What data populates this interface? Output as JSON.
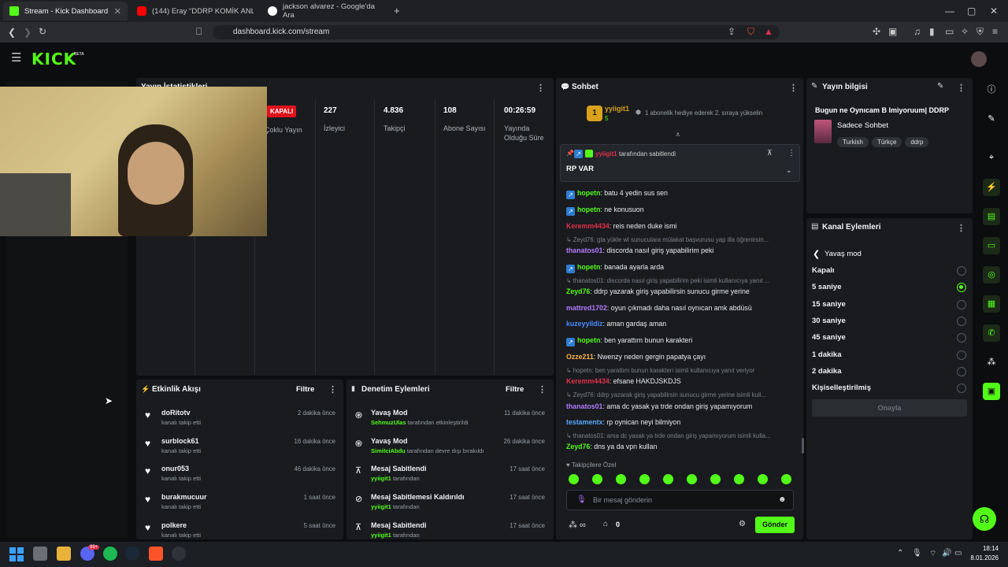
{
  "browser": {
    "tabs": [
      {
        "title": "Stream - Kick Dashboard",
        "color": "#53fc18"
      },
      {
        "title": "(144) Eray \"DDRP KOMİK ANLAR 11.",
        "color": "#ff0000"
      },
      {
        "title": "jackson alvarez - Google'da Ara",
        "color": "#ffffff"
      }
    ],
    "new_tab": "+",
    "url": "dashboard.kick.com/stream",
    "window_controls": [
      "—",
      "▢",
      "✕"
    ]
  },
  "kick": {
    "logo": "KICK",
    "beta": "BETA"
  },
  "stats_panel": {
    "title": "Yayın İstatistikleri",
    "status": "KAPALI",
    "multi_stream": "Çoklu Yayın",
    "stats": [
      {
        "value": "227",
        "label": "İzleyici"
      },
      {
        "value": "4.836",
        "label": "Takipçi"
      },
      {
        "value": "108",
        "label": "Abone Sayısı"
      },
      {
        "value": "00:26:59",
        "label": "Yayında Olduğu Süre"
      }
    ]
  },
  "chat": {
    "title": "Sohbet",
    "top_gifter": {
      "rank": "1",
      "name": "yyiigit1",
      "count": "5"
    },
    "gift_prompt": "1 abonelik hediye ederek 2. sıraya yükselin",
    "pinned": {
      "user": "yyiigit1",
      "suffix": "tarafından sabitlendi",
      "text": "RP VAR"
    },
    "messages": [
      {
        "type": "msg",
        "user": "hopetn",
        "color": "#53fc18",
        "badge": true,
        "text": ": batu 4 yedin sus sen"
      },
      {
        "type": "msg",
        "user": "hopetn",
        "color": "#53fc18",
        "badge": true,
        "text": ": ne konusuon"
      },
      {
        "type": "msg",
        "user": "Keremm4434",
        "color": "#e0314b",
        "badge": false,
        "text": ": reis neden duke ismi"
      },
      {
        "type": "reply",
        "text": "Zeyd76: gta yükle wl sunuculara mülakat başvurusu yap illa öğrenirsin..."
      },
      {
        "type": "msg",
        "user": "thanatos01",
        "color": "#b57bff",
        "badge": false,
        "text": ": discorda nasıl giriş yapabilirim peki"
      },
      {
        "type": "msg",
        "user": "hopetn",
        "color": "#53fc18",
        "badge": true,
        "text": ": banada ayarla arda"
      },
      {
        "type": "reply",
        "text": "thanatos01: discorda nasıl giriş yapabilirim peki isimli kullanıcıya yanıt ..."
      },
      {
        "type": "msg",
        "user": "Zeyd76",
        "color": "#53fc18",
        "badge": false,
        "text": ": ddrp yazarak giriş yapabilirsin sunucu girme yerine"
      },
      {
        "type": "msg",
        "user": "mattred1702",
        "color": "#b57bff",
        "badge": false,
        "text": ": oyun çıkmadı daha nasıl oynıcan amk abdüsü"
      },
      {
        "type": "msg",
        "user": "kuzeyyildiz",
        "color": "#4a8cff",
        "badge": false,
        "text": ": aman gardaş aman"
      },
      {
        "type": "msg",
        "user": "hopetn",
        "color": "#53fc18",
        "badge": true,
        "text": ": ben yarattım bunun karakteri"
      },
      {
        "type": "msg",
        "user": "Ozze211",
        "color": "#ffb347",
        "badge": false,
        "text": ": Nwenzy neden gergin papatya çayı"
      },
      {
        "type": "reply",
        "text": "hopetn: ben yarattım bunun karakteri isimli kullanıcıya yanıt veriyor"
      },
      {
        "type": "msg",
        "user": "Keremm4434",
        "color": "#e0314b",
        "badge": false,
        "text": ": efsane HAKDJSKDJS"
      },
      {
        "type": "reply",
        "text": "Zeyd76: ddrp yazarak giriş yapabilirsin sunucu girme yerine isimli kull..."
      },
      {
        "type": "msg",
        "user": "thanatos01",
        "color": "#b57bff",
        "badge": false,
        "text": ": ama dc yasak ya trde ondan giriş yapamıyorum"
      },
      {
        "type": "msg",
        "user": "testamentx",
        "color": "#5aa9ff",
        "badge": false,
        "text": ": rp oynican neyi bilmiyon"
      },
      {
        "type": "reply",
        "text": "thanatos01: ama dc yasak ya trde ondan giriş yapamıyorum isimli kulla..."
      },
      {
        "type": "msg",
        "user": "Zeyd76",
        "color": "#53fc18",
        "badge": false,
        "text": ": dns ya da vpn kullan"
      }
    ],
    "followers_only": "Takipçilere Özel",
    "input_placeholder": "Bir mesaj gönderin",
    "points": "0",
    "send": "Gönder"
  },
  "stream_info": {
    "title": "Yayın bilgisi",
    "stream_title": "Bugun ne Oynıcam B Imiyoruum| DDRP",
    "category": "Sadece Sohbet",
    "tags": [
      "Turkish",
      "Türkçe",
      "ddrp"
    ]
  },
  "channel_actions": {
    "title": "Kanal Eylemleri",
    "submenu": "Yavaş mod",
    "options": [
      {
        "label": "Kapalı",
        "selected": false
      },
      {
        "label": "5 saniye",
        "selected": true
      },
      {
        "label": "15 saniye",
        "selected": false
      },
      {
        "label": "30 saniye",
        "selected": false
      },
      {
        "label": "45 saniye",
        "selected": false
      },
      {
        "label": "1 dakika",
        "selected": false
      },
      {
        "label": "2 dakika",
        "selected": false
      },
      {
        "label": "Kişiselleştirilmiş",
        "selected": false
      }
    ],
    "confirm": "Onayla"
  },
  "activity": {
    "title": "Etkinlik Akışı",
    "filter": "Filtre",
    "items": [
      {
        "name": "doRitotv",
        "sub": "kanalı takip etti",
        "time": "2 dakika önce"
      },
      {
        "name": "surblock61",
        "sub": "kanalı takip etti",
        "time": "16 dakika önce"
      },
      {
        "name": "onur053",
        "sub": "kanalı takip etti",
        "time": "46 dakika önce"
      },
      {
        "name": "burakmucuur",
        "sub": "kanalı takip etti",
        "time": "1 saat önce"
      },
      {
        "name": "polkere",
        "sub": "kanalı takip etti",
        "time": "5 saat önce"
      }
    ]
  },
  "moderation": {
    "title": "Denetim Eylemleri",
    "filter": "Filtre",
    "items": [
      {
        "name": "Yavaş Mod",
        "user": "SehmuzUlas",
        "sub": "tarafından etkinleştirildi",
        "time": "11 dakika önce",
        "icon": "snail-icon"
      },
      {
        "name": "Yavaş Mod",
        "user": "SimitciAbdu",
        "sub": "tarafından devre dışı bırakıldı",
        "time": "26 dakika önce",
        "icon": "snail-icon"
      },
      {
        "name": "Mesaj Sabitlendi",
        "user": "yyiigit1",
        "sub": "tarafından",
        "time": "17 saat önce",
        "icon": "pin-icon"
      },
      {
        "name": "Mesaj Sabitlemesi Kaldırıldı",
        "user": "yyiigit1",
        "sub": "tarafından",
        "time": "17 saat önce",
        "icon": "unpin-icon"
      },
      {
        "name": "Mesaj Sabitlendi",
        "user": "yyiigit1",
        "sub": "tarafından",
        "time": "17 saat önce",
        "icon": "pin-icon"
      }
    ]
  },
  "taskbar": {
    "time": "18:14",
    "date": "8.01.2026",
    "badge": "99+"
  }
}
